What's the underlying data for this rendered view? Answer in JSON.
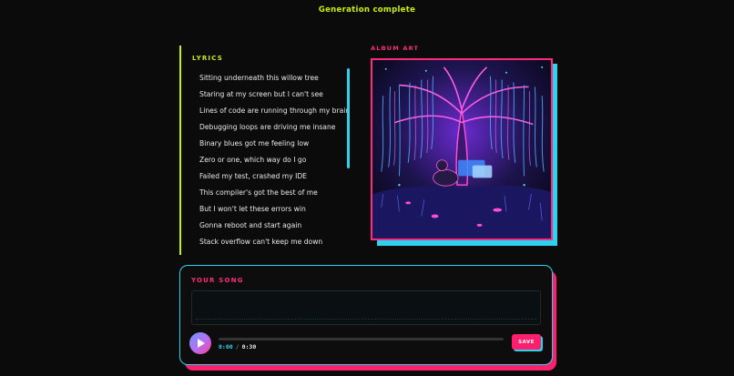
{
  "status": {
    "text": "Generation complete"
  },
  "lyrics": {
    "heading": "LYRICS",
    "lines": [
      "Sitting underneath this willow tree",
      "Staring at my screen but I can't see",
      "Lines of code are running through my brain",
      "Debugging loops are driving me insane",
      "Binary blues got me feeling low",
      "Zero or one, which way do I go",
      "Failed my test, crashed my IDE",
      "This compiler's got the best of me",
      "But I won't let these errors win",
      "Gonna reboot and start again",
      "Stack overflow can't keep me down"
    ]
  },
  "album": {
    "label": "ALBUM ART"
  },
  "song": {
    "heading": "YOUR SONG",
    "current_time": "0:00",
    "separator": "/",
    "duration": "0:30",
    "progress": 0,
    "save_label": "SAVE"
  },
  "colors": {
    "status": "#c8f000",
    "lyrics_accent": "#c8f000",
    "lyrics_scrollbar": "#2ad4f0",
    "album_label": "#ff2a7a",
    "album_border": "#ff2a7a",
    "album_shadow": "#2ad4f0",
    "song_heading": "#ff2a7a",
    "song_border": "#2ad4f0",
    "song_shadow": "#ff1f6d",
    "current_time": "#2ad4f0",
    "save_button": "#ff1f6d"
  },
  "icons": {
    "play": "play-icon"
  }
}
